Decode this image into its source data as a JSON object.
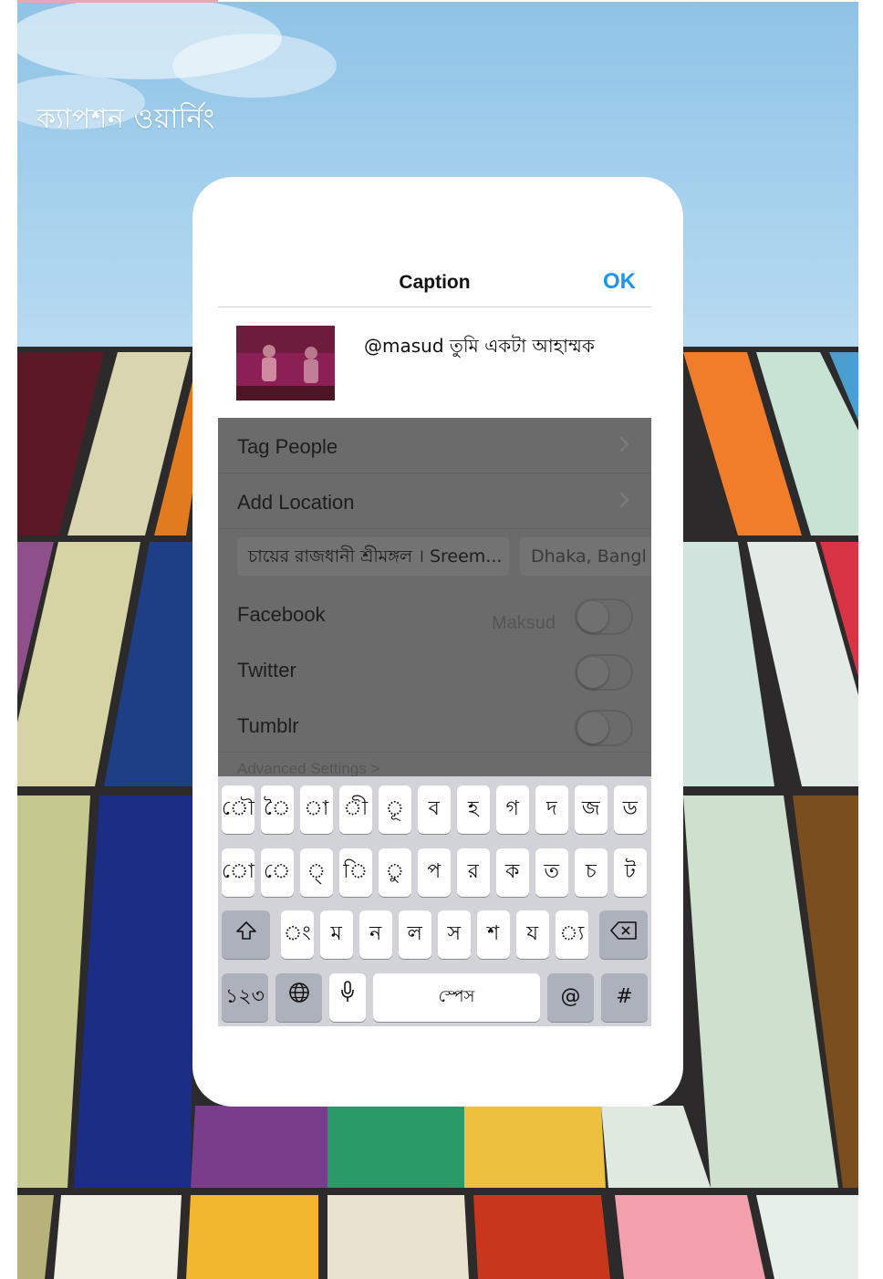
{
  "heading": "ক্যাপশন ওয়ার্নিং",
  "nav": {
    "title": "Caption",
    "ok_label": "OK"
  },
  "compose": {
    "caption": "@masud তুমি একটা আহাম্মক"
  },
  "settings": {
    "tag_people": "Tag People",
    "add_location": "Add Location",
    "location_suggestions": [
      "চায়ের রাজধানী শ্রীমঙ্গল । Sreem...",
      "Dhaka, Bangl"
    ],
    "facebook_label": "Facebook",
    "facebook_account": "Maksud",
    "twitter_label": "Twitter",
    "tumblr_label": "Tumblr",
    "advanced_label": "Advanced Settings >"
  },
  "keyboard": {
    "row1": [
      "ৌ",
      "ৈ",
      "া",
      "ী",
      "ূ",
      "ব",
      "হ",
      "গ",
      "দ",
      "জ",
      "ড"
    ],
    "row2": [
      "ো",
      "ে",
      "্",
      "ি",
      "ু",
      "প",
      "র",
      "ক",
      "ত",
      "চ",
      "ট"
    ],
    "row3": [
      "ং",
      "ম",
      "ন",
      "ল",
      "স",
      "শ",
      "য",
      "্য"
    ],
    "numbers_label": "১২৩",
    "space_label": "স্পেস",
    "at_label": "@",
    "hash_label": "#"
  },
  "colors": {
    "accent": "#1b95f0",
    "dim_overlay": "#6b6b6b",
    "keyboard_bg": "#d1d3d9"
  }
}
